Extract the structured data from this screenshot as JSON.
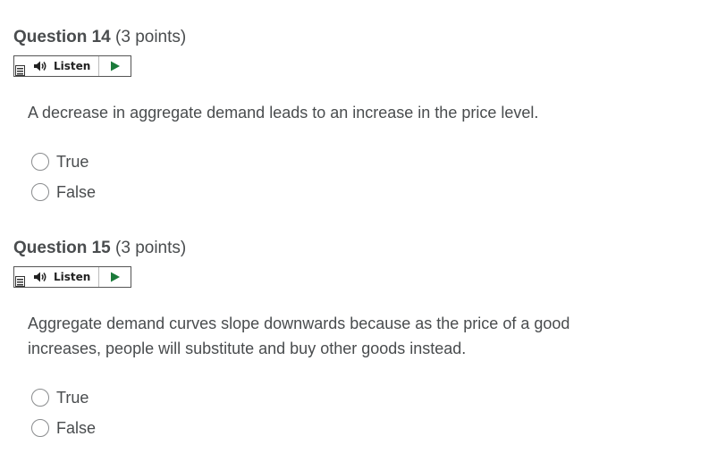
{
  "questions": [
    {
      "number_label": "Question 14",
      "points_label": "(3 points)",
      "listen_label": "Listen",
      "text": "A decrease in aggregate demand leads to an increase in the price level.",
      "choices": [
        "True",
        "False"
      ]
    },
    {
      "number_label": "Question 15",
      "points_label": "(3 points)",
      "listen_label": "Listen",
      "text": "Aggregate demand curves slope downwards because as the price of a good increases, people will substitute and buy other goods instead.",
      "choices": [
        "True",
        "False"
      ]
    }
  ],
  "icons": {
    "menu": "menu-lines-icon",
    "speaker": "speaker-icon",
    "play": "play-triangle-icon"
  },
  "colors": {
    "text": "#494c4e",
    "play_green": "#1b7a3a"
  }
}
